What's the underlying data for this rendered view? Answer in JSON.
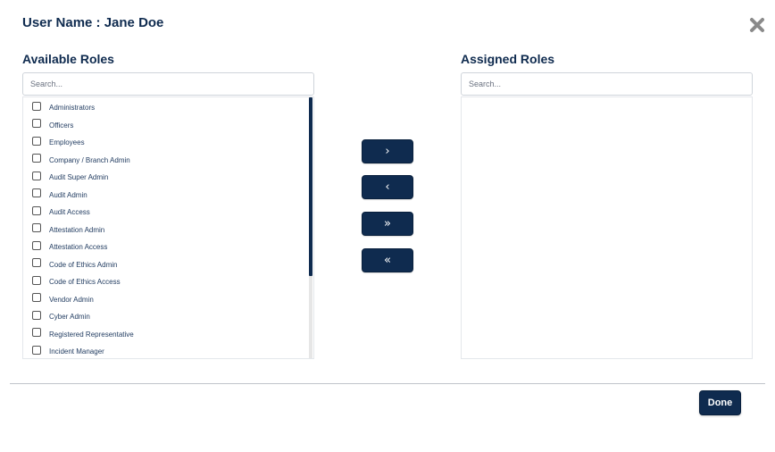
{
  "dialog": {
    "title": "User Name : Jane Doe",
    "close_icon": "close-x-icon"
  },
  "available": {
    "label": "Available Roles",
    "search_placeholder": "Search...",
    "roles": [
      {
        "label": "Administrators",
        "checked": false
      },
      {
        "label": "Officers",
        "checked": false
      },
      {
        "label": "Employees",
        "checked": false
      },
      {
        "label": "Company / Branch Admin",
        "checked": false
      },
      {
        "label": "Audit Super Admin",
        "checked": false
      },
      {
        "label": "Audit Admin",
        "checked": false
      },
      {
        "label": "Audit Access",
        "checked": false
      },
      {
        "label": "Attestation Admin",
        "checked": false
      },
      {
        "label": "Attestation Access",
        "checked": false
      },
      {
        "label": "Code of Ethics Admin",
        "checked": false
      },
      {
        "label": "Code of Ethics Access",
        "checked": false
      },
      {
        "label": "Vendor Admin",
        "checked": false
      },
      {
        "label": "Cyber Admin",
        "checked": false
      },
      {
        "label": "Registered Representative",
        "checked": false
      },
      {
        "label": "Incident Manager",
        "checked": false
      }
    ]
  },
  "assigned": {
    "label": "Assigned Roles",
    "search_placeholder": "Search...",
    "roles": []
  },
  "transfer": {
    "add": "›",
    "remove": "‹",
    "add_all": "»",
    "remove_all": "«"
  },
  "footer": {
    "done_label": "Done"
  },
  "colors": {
    "primary": "#0f2b4f",
    "border": "#cfd4da"
  }
}
